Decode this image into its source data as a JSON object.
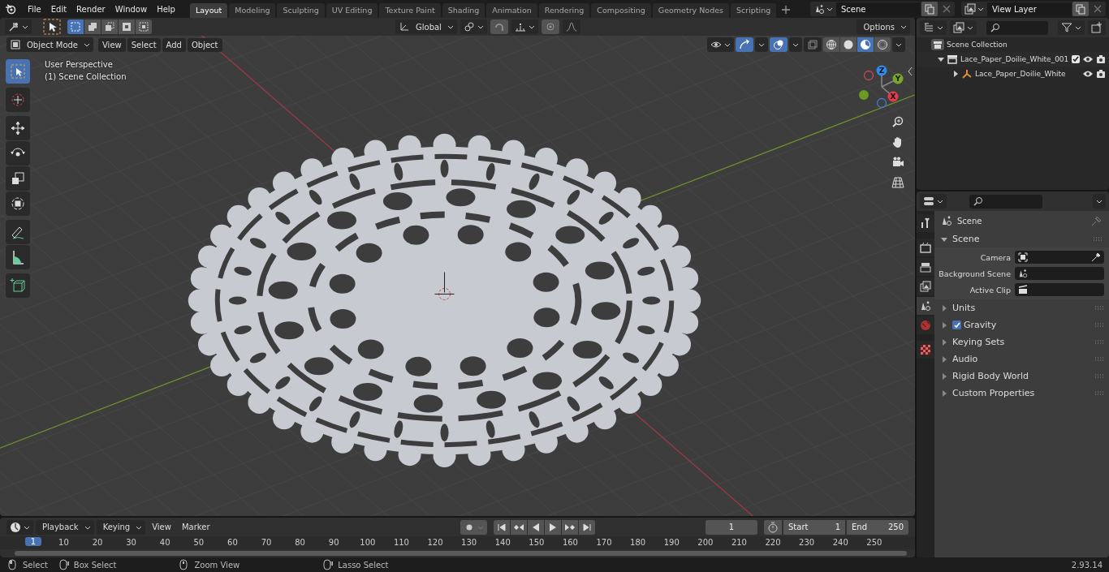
{
  "top_bar": {
    "menus": [
      "File",
      "Edit",
      "Render",
      "Window",
      "Help"
    ],
    "workspaces": [
      {
        "label": "Layout",
        "selected": true
      },
      {
        "label": "Modeling",
        "selected": false
      },
      {
        "label": "Sculpting",
        "selected": false
      },
      {
        "label": "UV Editing",
        "selected": false
      },
      {
        "label": "Texture Paint",
        "selected": false
      },
      {
        "label": "Shading",
        "selected": false
      },
      {
        "label": "Animation",
        "selected": false
      },
      {
        "label": "Rendering",
        "selected": false
      },
      {
        "label": "Compositing",
        "selected": false
      },
      {
        "label": "Geometry Nodes",
        "selected": false
      },
      {
        "label": "Scripting",
        "selected": false
      }
    ],
    "scene": "Scene",
    "view_layer": "View Layer"
  },
  "viewport": {
    "select_modes": [
      {
        "kind": "new",
        "selected": true
      },
      {
        "kind": "extend",
        "selected": false
      },
      {
        "kind": "subtract",
        "selected": false
      },
      {
        "kind": "difference",
        "selected": false
      },
      {
        "kind": "intersect",
        "selected": false
      }
    ],
    "orientation": "Global",
    "options": "Options",
    "mode": "Object Mode",
    "menus": [
      "View",
      "Select",
      "Add",
      "Object"
    ],
    "info": [
      "User Perspective",
      "(1) Scene Collection"
    ],
    "tool_groups": [
      [
        {
          "kind": "select_box",
          "selected": true
        }
      ],
      [
        {
          "kind": "cursor",
          "selected": false
        }
      ],
      [
        {
          "kind": "move",
          "selected": false
        },
        {
          "kind": "rotate",
          "selected": false
        },
        {
          "kind": "scale",
          "selected": false
        },
        {
          "kind": "transform",
          "selected": false
        }
      ],
      [
        {
          "kind": "annotate",
          "selected": false
        },
        {
          "kind": "measure",
          "selected": false
        }
      ],
      [
        {
          "kind": "add_cube",
          "selected": false
        }
      ]
    ],
    "toggles": [
      {
        "kind": "gizmos",
        "on": true
      },
      {
        "kind": "overlays",
        "on": true
      },
      {
        "kind": "xray",
        "on": false
      }
    ],
    "shading": [
      {
        "kind": "wireframe",
        "selected": false
      },
      {
        "kind": "solid",
        "selected": false
      },
      {
        "kind": "material",
        "selected": true
      },
      {
        "kind": "rendered",
        "selected": false
      }
    ],
    "gizmo_axes": [
      "Z",
      "Y",
      "X"
    ]
  },
  "outliner": {
    "items": [
      {
        "label": "Scene Collection",
        "kind": "scene_collection",
        "children": [
          {
            "label": "Lace_Paper_Doilie_White_001",
            "kind": "collection",
            "expanded": true,
            "checked": true,
            "children": [
              {
                "label": "Lace_Paper_Doilie_White",
                "kind": "object",
                "expanded": false
              }
            ]
          }
        ]
      }
    ]
  },
  "properties": {
    "tab_groups": [
      [
        {
          "kind": "tool",
          "selected": false
        }
      ],
      [
        {
          "kind": "render",
          "selected": false
        },
        {
          "kind": "output",
          "selected": false
        },
        {
          "kind": "view_layer",
          "selected": false
        },
        {
          "kind": "scene",
          "selected": true
        },
        {
          "kind": "world",
          "selected": false
        }
      ],
      [
        {
          "kind": "texture",
          "selected": false
        }
      ]
    ],
    "context": "Scene",
    "panel": {
      "title": "Scene",
      "expanded": true,
      "fields": [
        {
          "label": "Camera",
          "kind": "camera"
        },
        {
          "label": "Background Scene",
          "kind": "scene"
        },
        {
          "label": "Active Clip",
          "kind": "clip"
        }
      ]
    },
    "subpanels": [
      {
        "label": "Units",
        "kind": "plain",
        "expanded": false
      },
      {
        "label": "Gravity",
        "kind": "checkbox",
        "checked": true,
        "expanded": false
      },
      {
        "label": "Keying Sets",
        "kind": "plain",
        "expanded": false
      },
      {
        "label": "Audio",
        "kind": "plain",
        "expanded": false
      },
      {
        "label": "Rigid Body World",
        "kind": "plain",
        "expanded": false
      },
      {
        "label": "Custom Properties",
        "kind": "plain",
        "expanded": false
      }
    ]
  },
  "timeline": {
    "menus": [
      {
        "label": "Playback",
        "kind": "dropdown"
      },
      {
        "label": "Keying",
        "kind": "dropdown"
      },
      {
        "label": "View",
        "kind": "menu"
      },
      {
        "label": "Marker",
        "kind": "menu"
      }
    ],
    "current_frame": "1",
    "start_label": "Start",
    "start": "1",
    "end_label": "End",
    "end": "250",
    "playhead": "1",
    "ruler": [
      "10",
      "20",
      "30",
      "40",
      "50",
      "60",
      "70",
      "80",
      "90",
      "100",
      "110",
      "120",
      "130",
      "140",
      "150",
      "160",
      "170",
      "180",
      "190",
      "200",
      "210",
      "220",
      "230",
      "240",
      "250"
    ]
  },
  "status_bar": {
    "hints": [
      {
        "label": "Select",
        "kind": "mouse_left"
      },
      {
        "label": "Box Select",
        "kind": "mouse_drag"
      },
      {
        "label": "Zoom View",
        "kind": "mouse_middle"
      },
      {
        "label": "Lasso Select",
        "kind": "mouse_drag"
      }
    ],
    "version": "2.93.14"
  }
}
